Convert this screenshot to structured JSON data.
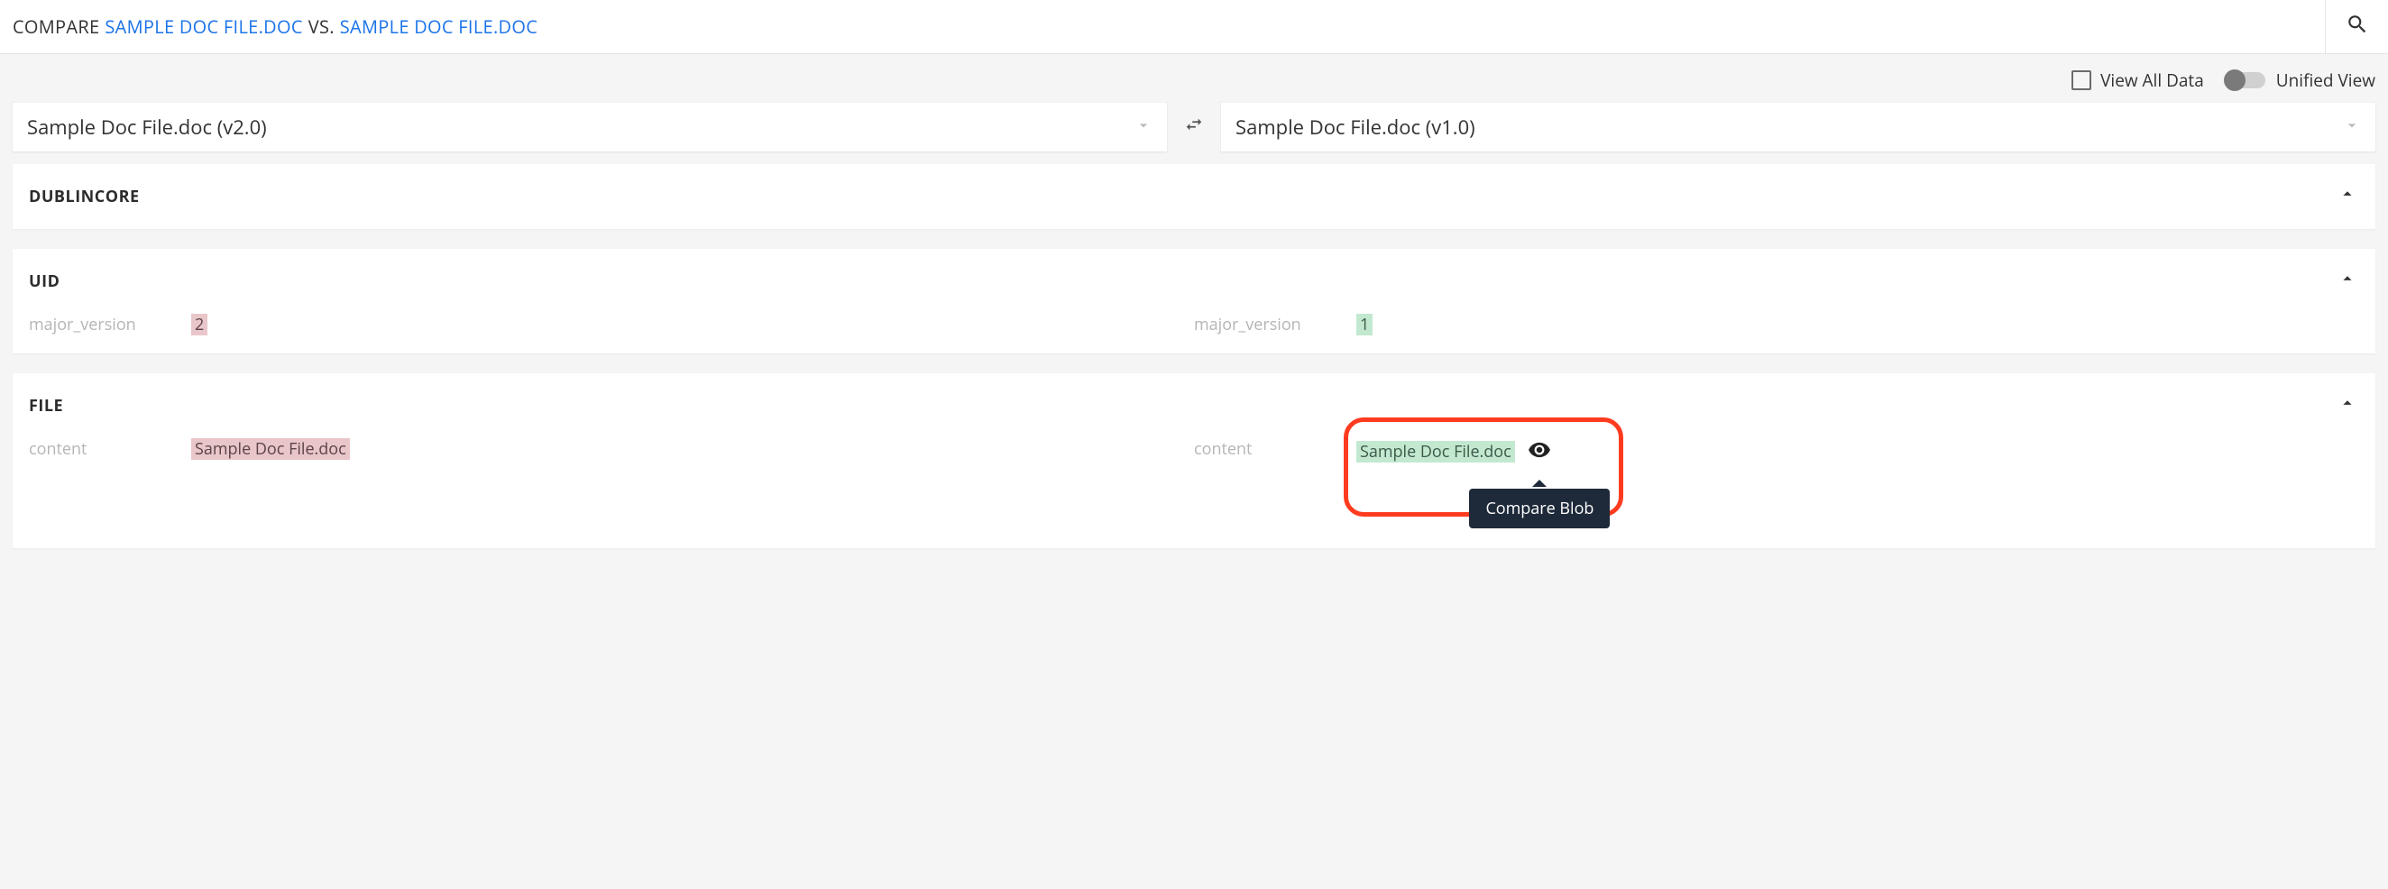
{
  "header": {
    "prefix": "COMPARE",
    "doc_left": "SAMPLE DOC FILE.DOC",
    "vs": "VS.",
    "doc_right": "SAMPLE DOC FILE.DOC"
  },
  "controls": {
    "view_all_label": "View All Data",
    "unified_label": "Unified View"
  },
  "selectors": {
    "left": "Sample Doc File.doc (v2.0)",
    "right": "Sample Doc File.doc (v1.0)"
  },
  "panels": {
    "dublincore": {
      "title": "DUBLINCORE"
    },
    "uid": {
      "title": "UID",
      "key": "major_version",
      "left_value": "2",
      "right_value": "1"
    },
    "file": {
      "title": "FILE",
      "key": "content",
      "left_value": "Sample Doc File.doc",
      "right_value": "Sample Doc File.doc"
    }
  },
  "tooltip": "Compare Blob"
}
